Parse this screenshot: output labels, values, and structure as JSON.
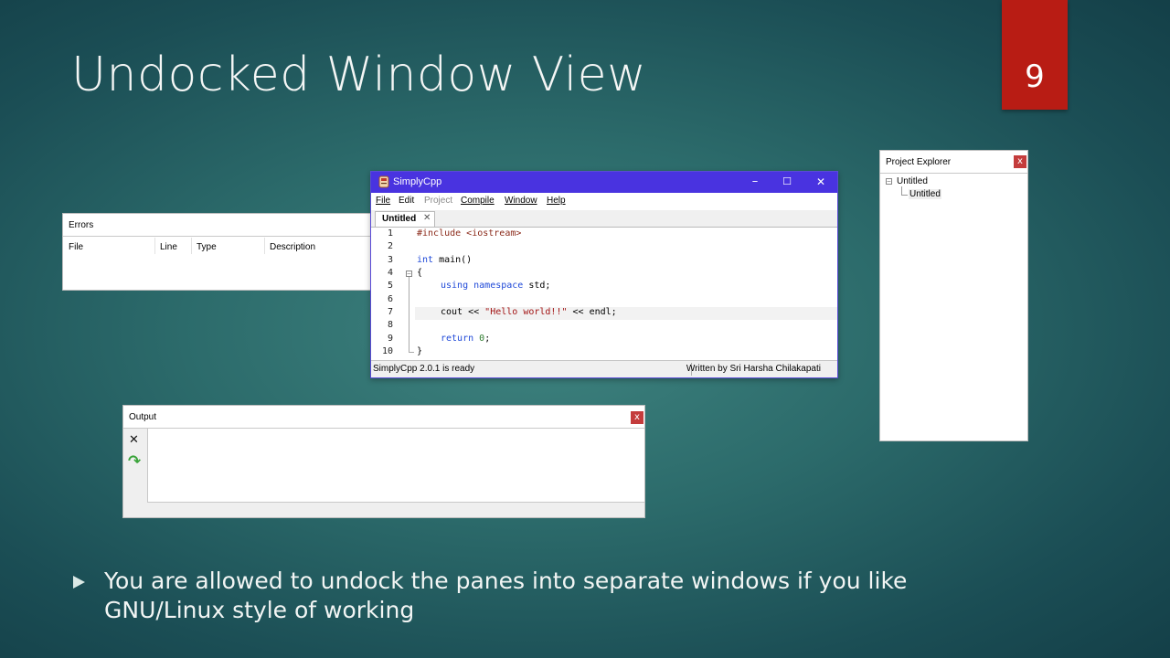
{
  "slide": {
    "title": "Undocked Window View",
    "page_number": "9",
    "bullet": "You are allowed to undock the panes into separate windows if you like GNU/Linux style of working"
  },
  "errors_pane": {
    "title": "Errors",
    "columns": [
      "File",
      "Line",
      "Type",
      "Description"
    ]
  },
  "ide": {
    "title": "SimplyCpp",
    "window_controls": {
      "minimize": "–",
      "maximize": "☐",
      "close": "✕"
    },
    "menu": [
      {
        "label": "File",
        "disabled": false
      },
      {
        "label": "Edit",
        "disabled": false
      },
      {
        "label": "Project",
        "disabled": true
      },
      {
        "label": "Compile",
        "disabled": false
      },
      {
        "label": "Window",
        "disabled": false
      },
      {
        "label": "Help",
        "disabled": false
      }
    ],
    "tab": {
      "label": "Untitled",
      "close": "✕"
    },
    "line_numbers": [
      "1",
      "2",
      "3",
      "4",
      "5",
      "6",
      "7",
      "8",
      "9",
      "10"
    ],
    "code": {
      "l1": "#include <iostream>",
      "l3_kw": "int",
      "l3_rest": " main()",
      "l4": "{",
      "l5_kw1": "using",
      "l5_kw2": "namespace",
      "l5_rest": " std;",
      "l7_a": "cout << ",
      "l7_str": "\"Hello world!!\"",
      "l7_b": " << endl;",
      "l9_kw": "return",
      "l9_num": "0",
      "l9_end": ";",
      "l10": "}"
    },
    "status_left": "SimplyCpp 2.0.1 is ready",
    "status_right": "Written by Sri Harsha Chilakapati"
  },
  "project_explorer": {
    "title": "Project Explorer",
    "close": "x",
    "root": "Untitled",
    "child": "Untitled"
  },
  "output_pane": {
    "title": "Output",
    "close": "x",
    "clear_glyph": "✕",
    "rerun_glyph": "↷"
  },
  "colors": {
    "page_badge": "#b81c14",
    "ide_titlebar": "#4933e0",
    "close_button": "#c43c3c"
  }
}
